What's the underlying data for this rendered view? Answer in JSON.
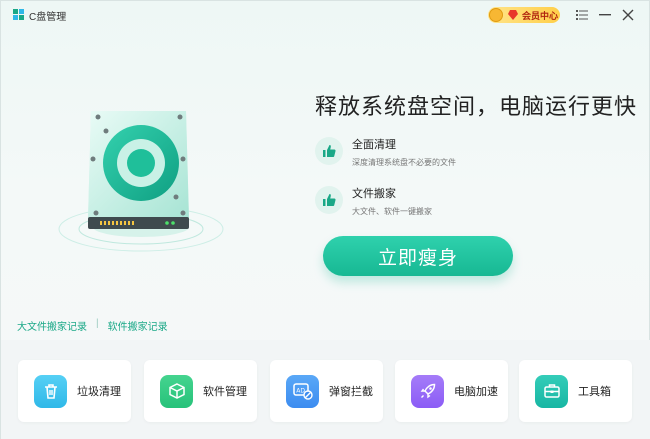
{
  "app": {
    "title": "C盘管理"
  },
  "titlebar": {
    "vip_label": "会员中心",
    "menu_icon": "list-icon",
    "minimize_icon": "minimize-icon",
    "close_icon": "close-icon"
  },
  "hero": {
    "headline": "释放系统盘空间，电脑运行更快",
    "features": [
      {
        "title": "全面清理",
        "desc": "深度清理系统盘不必要的文件",
        "icon": "thumbs-up-icon"
      },
      {
        "title": "文件搬家",
        "desc": "大文件、软件一键搬家",
        "icon": "thumbs-up-icon"
      }
    ],
    "cta_label": "立即瘦身"
  },
  "links": {
    "big_file_log": "大文件搬家记录",
    "separator": "|",
    "software_log": "软件搬家记录"
  },
  "tools": [
    {
      "label": "垃圾清理",
      "icon": "trash-icon",
      "color": "#2fb8e8"
    },
    {
      "label": "软件管理",
      "icon": "cube-icon",
      "color": "#27c27a"
    },
    {
      "label": "弹窗拦截",
      "icon": "ad-block-icon",
      "color": "#3c8cf0"
    },
    {
      "label": "电脑加速",
      "icon": "rocket-icon",
      "color": "#8b5cf6"
    },
    {
      "label": "工具箱",
      "icon": "toolbox-icon",
      "color": "#17b6a3"
    }
  ],
  "colors": {
    "accent": "#17b893",
    "link": "#1aa887",
    "vip_text": "#b0250f"
  }
}
